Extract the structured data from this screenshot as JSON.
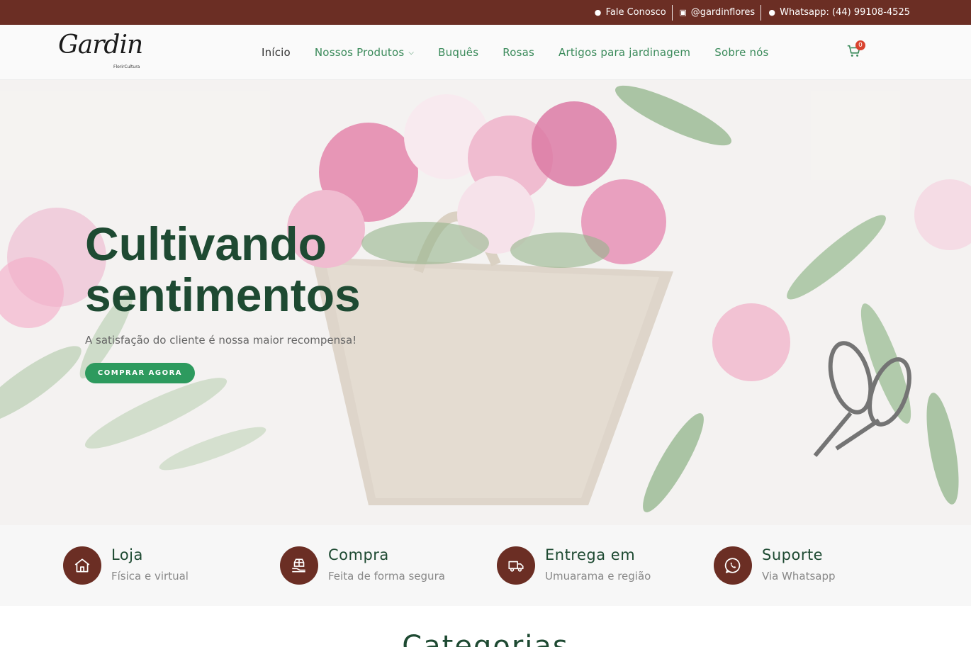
{
  "topbar": {
    "contact": "Fale Conosco",
    "instagram": "@gardinflores",
    "whatsapp": "Whatsapp: (44) 99108-4525"
  },
  "header": {
    "logo_text": "Gardin",
    "logo_sub": "FlorirCultura",
    "nav": [
      "Início",
      "Nossos Produtos",
      "Buquês",
      "Rosas",
      "Artigos para jardinagem",
      "Sobre nós"
    ],
    "cart_count": "0"
  },
  "hero": {
    "title_line1": "Cultivando",
    "title_line2": "sentimentos",
    "tagline": "A satisfação do cliente é nossa maior recompensa!",
    "cta": "COMPRAR AGORA"
  },
  "features": [
    {
      "icon": "house-icon",
      "title": "Loja",
      "sub": "Física e virtual"
    },
    {
      "icon": "box-hand-icon",
      "title": "Compra",
      "sub": "Feita de forma segura"
    },
    {
      "icon": "truck-icon",
      "title": "Entrega em",
      "sub": "Umuarama e região"
    },
    {
      "icon": "whatsapp-icon",
      "title": "Suporte",
      "sub": "Via Whatsapp"
    }
  ],
  "categories": {
    "title": "Categorias"
  },
  "colors": {
    "brand_brown": "#6b2e24",
    "brand_green": "#1e4a32",
    "accent_green": "#2d9a5e",
    "nav_green": "#3a8a5a"
  }
}
